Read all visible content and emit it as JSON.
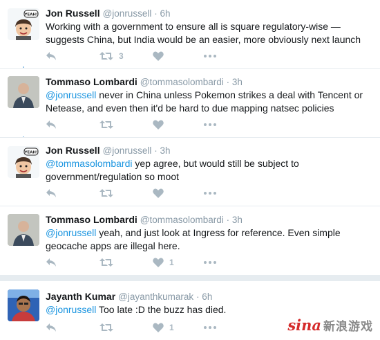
{
  "tweets": [
    {
      "name": "Jon Russell",
      "handle": "@jonrussell",
      "time": "· 6h",
      "mention": "",
      "text": "Working with a government to ensure all is square regulatory-wise — suggests China, but India would be an easier, more obviously next launch",
      "retweet_count": "3",
      "like_count": "",
      "avatar_badge": "YEAH!"
    },
    {
      "name": "Tommaso Lombardi",
      "handle": "@tommasolombardi",
      "time": "· 3h",
      "mention": "@jonrussell",
      "text": " never in China unless Pokemon strikes a deal with Tencent or Netease, and even then it'd be hard to due mapping natsec policies",
      "retweet_count": "",
      "like_count": ""
    },
    {
      "name": "Jon Russell",
      "handle": "@jonrussell",
      "time": "· 3h",
      "mention": "@tommasolombardi",
      "text": " yep agree, but would still be subject to government/regulation so moot",
      "retweet_count": "",
      "like_count": "",
      "avatar_badge": "YEAH!"
    },
    {
      "name": "Tommaso Lombardi",
      "handle": "@tommasolombardi",
      "time": "· 3h",
      "mention": "@jonrussell",
      "text": " yeah, and just look at Ingress for reference. Even simple geocache apps are illegal here.",
      "retweet_count": "",
      "like_count": "1"
    },
    {
      "name": "Jayanth Kumar",
      "handle": "@jayanthkumarak",
      "time": "· 6h",
      "mention": "@jonrussell",
      "text": " Too late :D the buzz has died.",
      "retweet_count": "",
      "like_count": "1"
    }
  ],
  "icons": {
    "reply": "reply-icon",
    "retweet": "retweet-icon",
    "like": "heart-icon",
    "more": "more-icon"
  },
  "colors": {
    "mention": "#1b95e0",
    "icon": "#aab8c2",
    "thread_line": "#9ac6e8"
  },
  "watermark": {
    "logo": "sina",
    "text": "新浪游戏"
  }
}
